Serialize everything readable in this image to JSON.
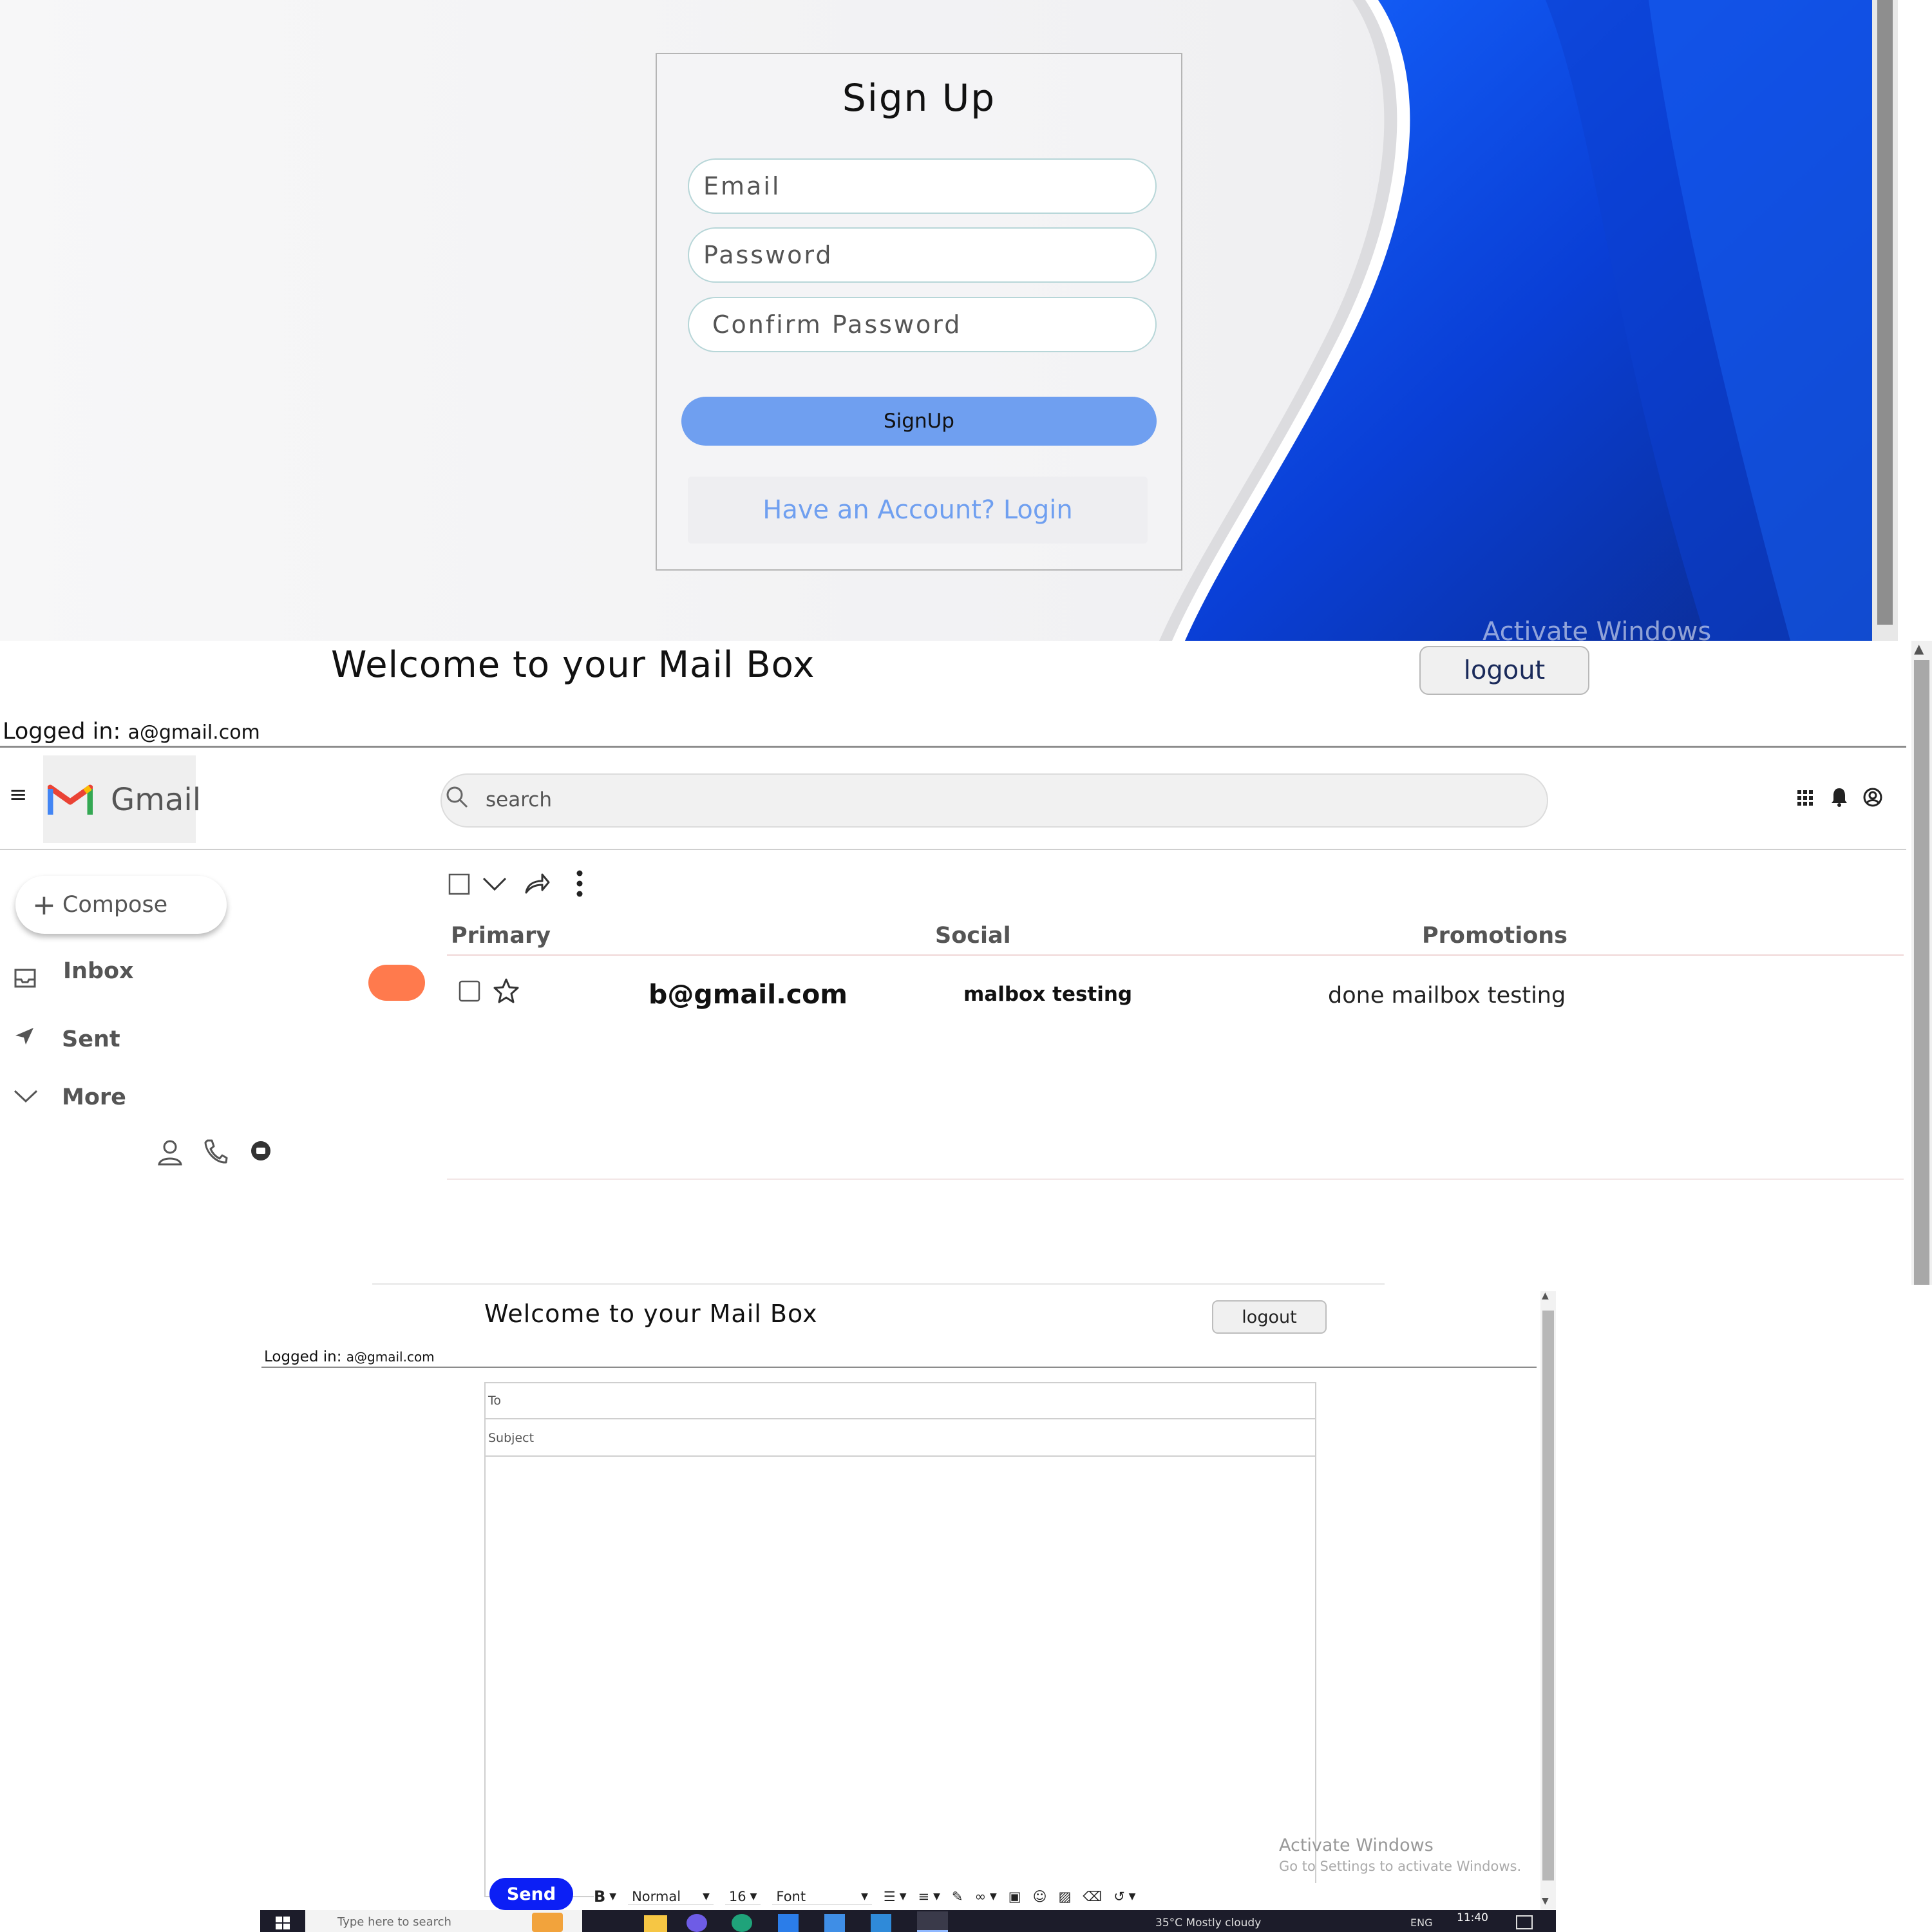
{
  "signup": {
    "title": "Sign Up",
    "email_placeholder": "Email",
    "password_placeholder": "Password",
    "confirm_placeholder": "Confirm Password",
    "button_label": "SignUp",
    "login_link": "Have an Account? Login",
    "watermark": "Activate Windows"
  },
  "mailbox": {
    "welcome": "Welcome to your Mail Box",
    "logout_label": "logout",
    "logged_in_label": "Logged in:",
    "logged_in_email": "a@gmail.com",
    "brand": "Gmail",
    "search_placeholder": "search",
    "compose_label": "Compose",
    "nav": [
      {
        "label": "Inbox",
        "icon": "inbox-icon"
      },
      {
        "label": "Sent",
        "icon": "send-icon"
      },
      {
        "label": "More",
        "icon": "chevron-down-icon"
      }
    ],
    "tabs": [
      {
        "label": "Primary"
      },
      {
        "label": "Social"
      },
      {
        "label": "Promotions"
      }
    ],
    "messages": [
      {
        "sender": "b@gmail.com",
        "subject": "malbox testing",
        "body": "done mailbox testing"
      }
    ],
    "accent_colors": {
      "badge": "#ff7a4d",
      "gmail_red": "#ea4335"
    }
  },
  "compose": {
    "welcome": "Welcome to your Mail Box",
    "logout_label": "logout",
    "logged_in_label": "Logged in:",
    "logged_in_email": "a@gmail.com",
    "to_placeholder": "To",
    "subject_placeholder": "Subject",
    "send_label": "Send",
    "toolbar": {
      "bold": "B",
      "style_select": "Normal",
      "size_select": "16",
      "font_select": "Font"
    },
    "watermark_title": "Activate Windows",
    "watermark_sub": "Go to Settings to activate Windows.",
    "send_color": "#0c1ff5"
  },
  "taskbar": {
    "search_placeholder": "Type here to search",
    "weather": "35°C  Mostly cloudy",
    "language": "ENG",
    "time": "11:40"
  }
}
